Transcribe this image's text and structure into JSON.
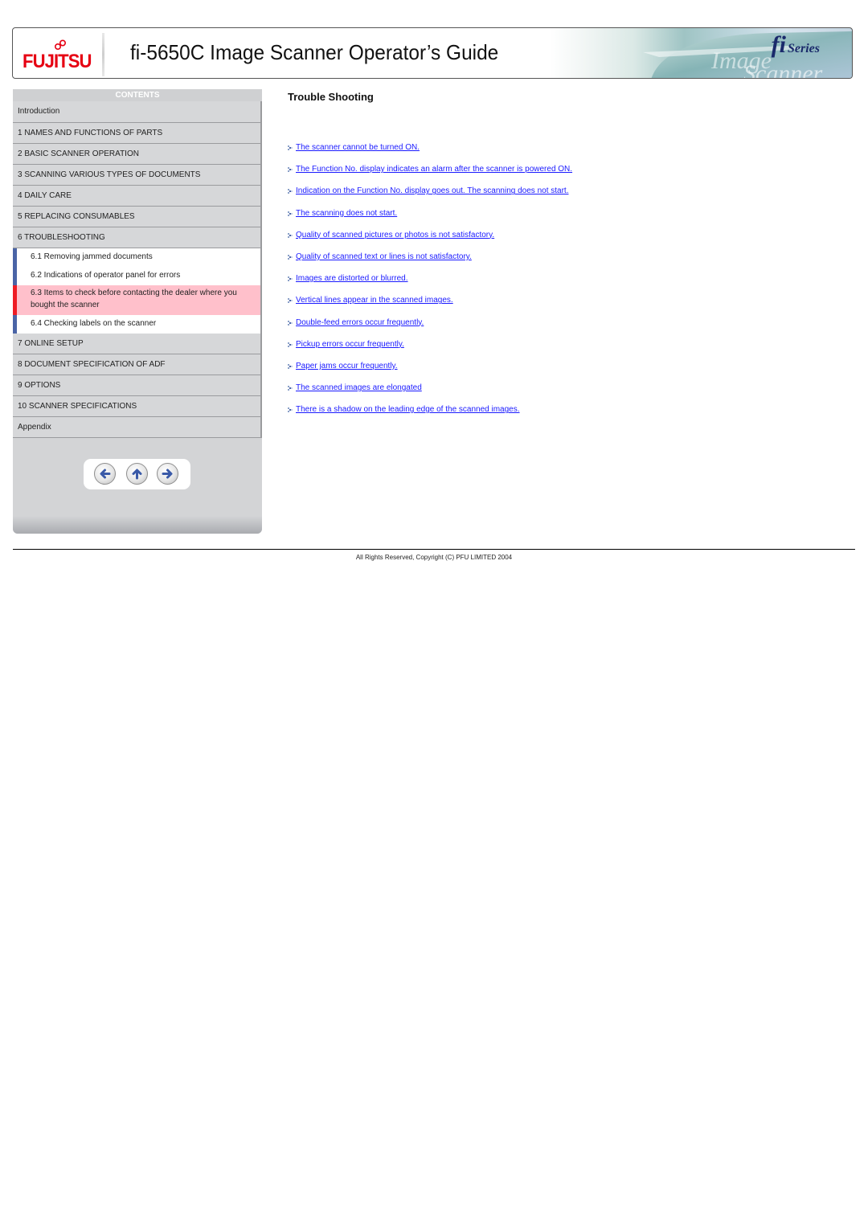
{
  "header": {
    "brand": "FUJITSU",
    "title": "fi-5650C Image Scanner Operator’s Guide",
    "series_badge": {
      "fi": "fi",
      "series": "Series"
    },
    "brand_color": "#e60012"
  },
  "sidebar": {
    "heading": "CONTENTS",
    "items": [
      {
        "label": "Introduction"
      },
      {
        "label": "1 NAMES AND FUNCTIONS OF PARTS"
      },
      {
        "label": "2 BASIC SCANNER OPERATION"
      },
      {
        "label": "3 SCANNING VARIOUS TYPES OF DOCUMENTS"
      },
      {
        "label": "4 DAILY CARE"
      },
      {
        "label": "5 REPLACING CONSUMABLES"
      },
      {
        "label": "6 TROUBLESHOOTING"
      },
      {
        "label": "7 ONLINE SETUP"
      },
      {
        "label": "8 DOCUMENT SPECIFICATION OF ADF"
      },
      {
        "label": "9 OPTIONS"
      },
      {
        "label": "10 SCANNER SPECIFICATIONS"
      },
      {
        "label": "Appendix"
      }
    ],
    "subitems": [
      {
        "label": "6.1 Removing jammed documents",
        "active": false
      },
      {
        "label": "6.2 Indications of operator panel for errors",
        "active": false
      },
      {
        "label": "6.3 Items to check before contacting the dealer where you bought the scanner",
        "active": true
      },
      {
        "label": "6.4 Checking labels on the scanner",
        "active": false
      }
    ],
    "nav_buttons": [
      {
        "icon": "arrow-left-icon",
        "label": "Previous"
      },
      {
        "icon": "arrow-up-icon",
        "label": "Up"
      },
      {
        "icon": "arrow-right-icon",
        "label": "Next"
      }
    ],
    "accent_color": "#4a64a6",
    "active_color": "#ee1c25",
    "active_background": "#ffc0cb"
  },
  "main": {
    "title": "Trouble Shooting",
    "links": [
      "The scanner cannot be turned ON.",
      "The Function No. display indicates an alarm after the scanner is powered ON.",
      "Indication on the Function No. display goes out. The scanning does not start.",
      "The scanning does not start.",
      "Quality of scanned pictures or photos is not satisfactory.",
      "Quality of scanned text or lines is not satisfactory.",
      "Images are distorted or blurred.",
      "Vertical lines appear in the scanned images.",
      "Double-feed errors occur frequently.",
      "Pickup errors occur frequently.",
      "Paper jams occur frequently.",
      "The scanned images are elongated",
      "There is a shadow on the leading edge of the scanned images."
    ],
    "link_color": "#1a1aff"
  },
  "footer": {
    "copyright": "All Rights Reserved, Copyright (C) PFU LIMITED 2004"
  }
}
